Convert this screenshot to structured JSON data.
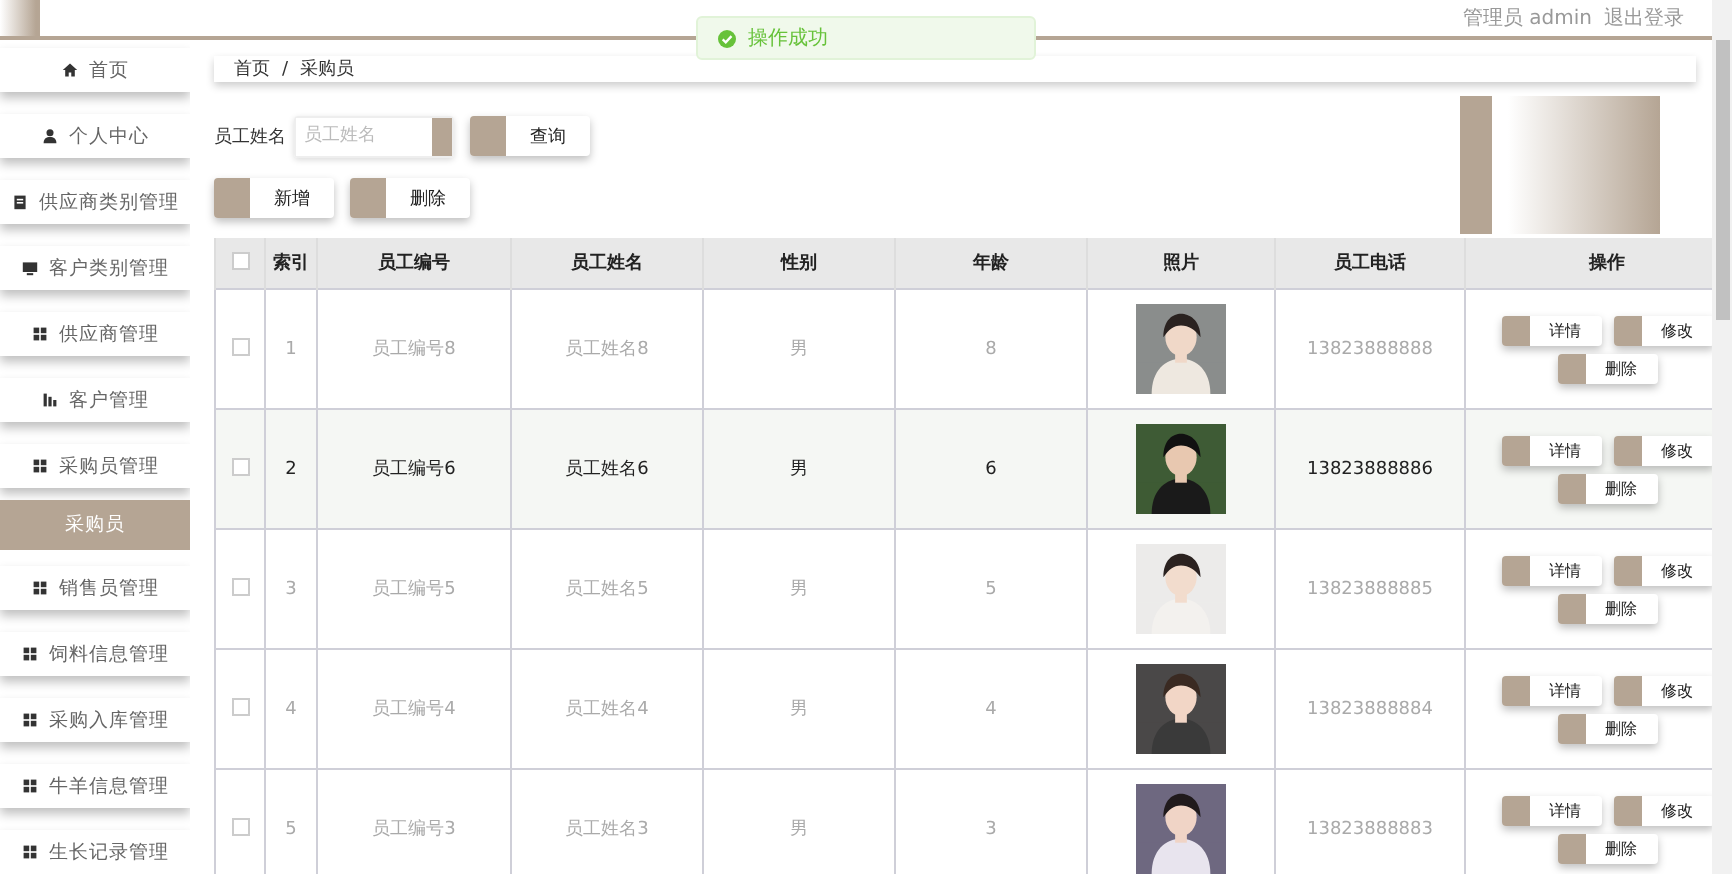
{
  "header": {
    "user_label": "管理员 admin",
    "logout": "退出登录"
  },
  "toast": {
    "message": "操作成功"
  },
  "sidebar": {
    "items": [
      {
        "label": "首页",
        "selected": false
      },
      {
        "label": "个人中心",
        "selected": false
      },
      {
        "label": "供应商类别管理",
        "selected": false
      },
      {
        "label": "客户类别管理",
        "selected": false
      },
      {
        "label": "供应商管理",
        "selected": false
      },
      {
        "label": "客户管理",
        "selected": false
      },
      {
        "label": "采购员管理",
        "selected": false
      },
      {
        "label": "采购员",
        "selected": true
      },
      {
        "label": "销售员管理",
        "selected": false
      },
      {
        "label": "饲料信息管理",
        "selected": false
      },
      {
        "label": "采购入库管理",
        "selected": false
      },
      {
        "label": "牛羊信息管理",
        "selected": false
      },
      {
        "label": "生长记录管理",
        "selected": false
      }
    ]
  },
  "breadcrumb": [
    "首页",
    "采购员"
  ],
  "breadcrumb_separator": "/",
  "search": {
    "label": "员工姓名",
    "placeholder": "员工姓名",
    "button": "查询"
  },
  "actions": [
    "新增",
    "删除"
  ],
  "table": {
    "select_all_checked": false,
    "columns": [
      "索引",
      "员工编号",
      "员工姓名",
      "性别",
      "年龄",
      "照片",
      "员工电话",
      "操作"
    ],
    "rows": [
      {
        "checked": false,
        "hovered": false,
        "cells": [
          "1",
          "员工编号8",
          "员工姓名8",
          "男",
          "8"
        ],
        "phone": "13823888888",
        "buttons": [
          "详情",
          "修改",
          "删除"
        ]
      },
      {
        "checked": false,
        "hovered": true,
        "cells": [
          "2",
          "员工编号6",
          "员工姓名6",
          "男",
          "6"
        ],
        "phone": "13823888886",
        "buttons": [
          "详情",
          "修改",
          "删除"
        ]
      },
      {
        "checked": false,
        "hovered": false,
        "cells": [
          "3",
          "员工编号5",
          "员工姓名5",
          "男",
          "5"
        ],
        "phone": "13823888885",
        "buttons": [
          "详情",
          "修改",
          "删除"
        ]
      },
      {
        "checked": false,
        "hovered": false,
        "cells": [
          "4",
          "员工编号4",
          "员工姓名4",
          "男",
          "4"
        ],
        "phone": "13823888884",
        "buttons": [
          "详情",
          "修改",
          "删除"
        ]
      },
      {
        "checked": false,
        "hovered": false,
        "cells": [
          "5",
          "员工编号3",
          "员工姓名3",
          "男",
          "3"
        ],
        "phone": "13823888883",
        "buttons": [
          "详情",
          "修改",
          "删除"
        ]
      }
    ]
  }
}
